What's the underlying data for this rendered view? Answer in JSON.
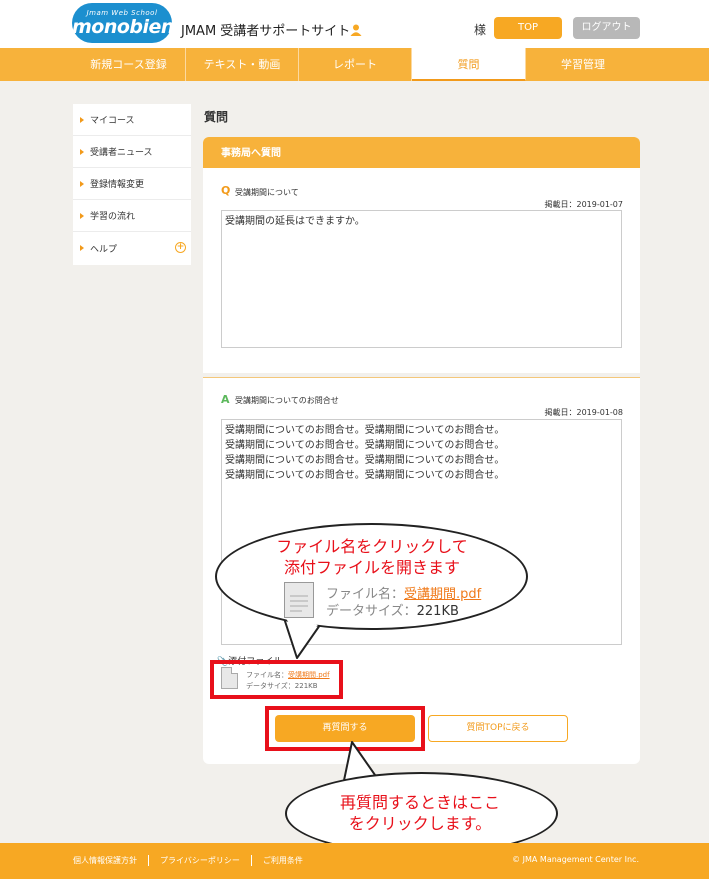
{
  "header": {
    "logo_sub": "Jmam Web School",
    "logo_main": "monobien",
    "site_title": "JMAM 受講者サポートサイト",
    "honorific": "様",
    "top_button": "TOP",
    "logout_button": "ログアウト"
  },
  "nav": {
    "items": [
      "新規コース登録",
      "テキスト・動画",
      "レポート",
      "質問",
      "学習管理"
    ],
    "active": "質問"
  },
  "sidebar": {
    "items": [
      "マイコース",
      "受講者ニュース",
      "登録情報変更",
      "学習の流れ",
      "ヘルプ"
    ]
  },
  "main": {
    "page_title": "質問",
    "panel_title": "事務局へ質問",
    "question": {
      "mark": "Q",
      "subject": "受講期間について",
      "date": "掲載日：2019-01-07",
      "body": "受講期間の延長はできますか。"
    },
    "answer": {
      "mark": "A",
      "subject": "受講期間についてのお問合せ",
      "date": "掲載日：2019-01-08",
      "lines": [
        "受講期間についてのお問合せ。受講期間についてのお問合せ。",
        "受講期間についてのお問合せ。受講期間についてのお問合せ。",
        "受講期間についてのお問合せ。受講期間についてのお問合せ。",
        "受講期間についてのお問合せ。受講期間についてのお問合せ。"
      ]
    },
    "attachment": {
      "label": "添付ファイル",
      "file_name_label": "ファイル名：",
      "file_name": "受講期間.pdf",
      "data_size_label": "データサイズ：",
      "data_size": "221KB"
    },
    "reask_button": "再質問する",
    "back_button": "質問TOPに戻る"
  },
  "callouts": {
    "top": [
      "ファイル名をクリックして",
      "添付ファイルを開きます"
    ],
    "bottom": [
      "再質問するときはここ",
      "をクリックします。"
    ],
    "zoom_file_name_label": "ファイル名：",
    "zoom_file_name": "受講期間.pdf",
    "zoom_size_label": "データサイズ：",
    "zoom_size": "221KB"
  },
  "footer": {
    "links": [
      "個人情報保護方針",
      "プライバシーポリシー",
      "ご利用条件"
    ],
    "copyright": "© JMA Management Center Inc."
  },
  "colors": {
    "accent_orange": "#f7a823",
    "logo_blue": "#1c8fcf",
    "highlight_red": "#e8101a"
  }
}
